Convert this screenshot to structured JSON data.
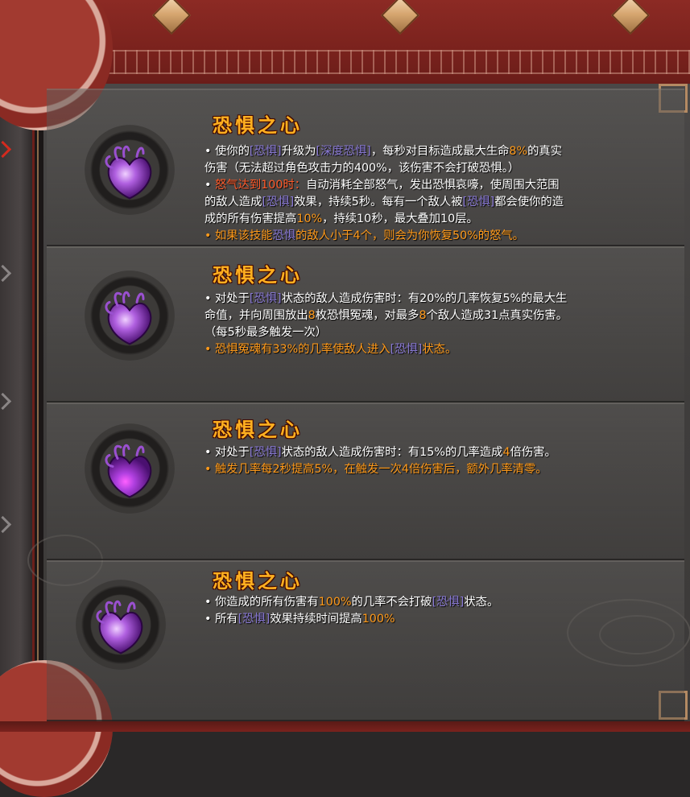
{
  "cards": [
    {
      "title": "恐惧之心",
      "lines": [
        [
          {
            "t": "• 使你的"
          },
          {
            "t": "[恐惧]",
            "c": "kw"
          },
          {
            "t": "升级为"
          },
          {
            "t": "[深度恐惧]",
            "c": "kw"
          },
          {
            "t": "，每秒对目标造成最大生命"
          },
          {
            "t": "8%",
            "c": "num"
          },
          {
            "t": "的真实"
          }
        ],
        [
          {
            "t": "伤害（无法超过角色攻击力的400%，该伤害不会打破恐惧。）"
          }
        ],
        [
          {
            "t": "• "
          },
          {
            "t": "怒气达到100时：",
            "c": "red"
          },
          {
            "t": "自动消耗全部怒气，发出恐惧哀嚎，使周围大范围"
          }
        ],
        [
          {
            "t": "的敌人造成"
          },
          {
            "t": "[恐惧]",
            "c": "kw"
          },
          {
            "t": "效果，持续5秒。每有一个敌人被"
          },
          {
            "t": "[恐惧]",
            "c": "kw"
          },
          {
            "t": "都会使你的造"
          }
        ],
        [
          {
            "t": "成的所有伤害提高"
          },
          {
            "t": "10%",
            "c": "num"
          },
          {
            "t": "，持续10秒，最大叠加10层。"
          }
        ],
        [
          {
            "t": "• 如果该技能",
            "c": "orange"
          },
          {
            "t": "恐惧",
            "c": "kw"
          },
          {
            "t": "的敌人小于4个，则会为你恢复50%的怒气。",
            "c": "orange"
          }
        ]
      ]
    },
    {
      "title": "恐惧之心",
      "lines": [
        [
          {
            "t": "• 对处于"
          },
          {
            "t": "[恐惧]",
            "c": "kw"
          },
          {
            "t": "状态的敌人造成伤害时：有20%的几率恢复5%的最大生"
          }
        ],
        [
          {
            "t": "命值，并向周围放出"
          },
          {
            "t": "8",
            "c": "num"
          },
          {
            "t": "枚恐惧冤魂，对最多"
          },
          {
            "t": "8",
            "c": "num"
          },
          {
            "t": "个敌人造成31点真实伤害。"
          }
        ],
        [
          {
            "t": "（每5秒最多触发一次）"
          }
        ],
        [
          {
            "t": "• 恐惧冤魂有33%的几率使敌人进入",
            "c": "orange"
          },
          {
            "t": "[恐惧]",
            "c": "kw"
          },
          {
            "t": "状态。",
            "c": "orange"
          }
        ]
      ]
    },
    {
      "title": "恐惧之心",
      "lines": [
        [
          {
            "t": "• 对处于"
          },
          {
            "t": "[恐惧]",
            "c": "kw"
          },
          {
            "t": "状态的敌人造成伤害时：有15%的几率造成"
          },
          {
            "t": "4",
            "c": "num"
          },
          {
            "t": "倍伤害。"
          }
        ],
        [
          {
            "t": "• 触发几率每2秒提高5%，在触发一次4倍伤害后，额外几率清零。",
            "c": "orange"
          }
        ]
      ]
    },
    {
      "title": "恐惧之心",
      "lines": [
        [
          {
            "t": "• 你造成的所有伤害有"
          },
          {
            "t": "100%",
            "c": "num"
          },
          {
            "t": "的几率不会打破"
          },
          {
            "t": "[恐惧]",
            "c": "kw"
          },
          {
            "t": "状态。"
          }
        ],
        [
          {
            "t": "• 所有"
          },
          {
            "t": "[恐惧]",
            "c": "kw"
          },
          {
            "t": "效果持续时间提高"
          },
          {
            "t": "100%",
            "c": "num"
          }
        ]
      ]
    }
  ],
  "colors": {
    "title": "#ffb020",
    "keyword": "#8a7ad6",
    "number": "#ff9a1a",
    "warning": "#ff5a2a"
  },
  "icon": "fear-heart-icon"
}
